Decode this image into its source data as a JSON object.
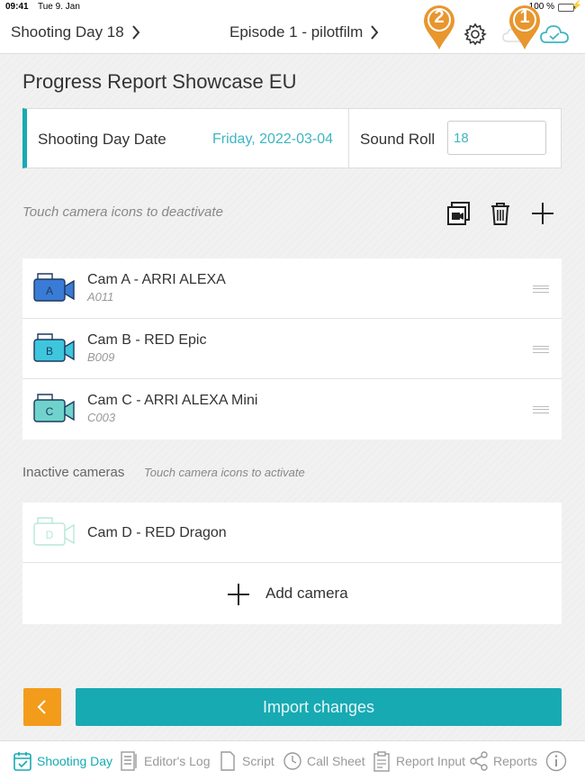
{
  "status_bar": {
    "time": "09:41",
    "date": "Tue 9. Jan",
    "battery": "100 %"
  },
  "nav": {
    "back_label": "Shooting Day 18",
    "episode_label": "Episode 1 - pilotfilm"
  },
  "markers": {
    "marker1": "1",
    "marker2": "2"
  },
  "page_title": "Progress Report Showcase EU",
  "shooting_day": {
    "date_label": "Shooting Day Date",
    "date_value": "Friday, 2022-03-04",
    "sound_roll_label": "Sound Roll",
    "sound_roll_value": "18"
  },
  "active_hint": "Touch camera icons to deactivate",
  "cameras": [
    {
      "letter": "A",
      "name": "Cam A - ARRI ALEXA",
      "code": "A011",
      "color": "#3a7bd5"
    },
    {
      "letter": "B",
      "name": "Cam B - RED Epic",
      "code": "B009",
      "color": "#3ec6dd"
    },
    {
      "letter": "C",
      "name": "Cam C - ARRI ALEXA Mini",
      "code": "C003",
      "color": "#6fd3cc"
    }
  ],
  "inactive": {
    "title": "Inactive cameras",
    "hint": "Touch camera icons to activate",
    "cameras": [
      {
        "letter": "D",
        "name": "Cam D - RED Dragon",
        "color": "#b8e8d9"
      }
    ],
    "add_label": "Add camera"
  },
  "import_label": "Import changes",
  "tabs": [
    {
      "label": "Shooting Day",
      "icon": "calendar-icon"
    },
    {
      "label": "Editor's Log",
      "icon": "editor-log-icon"
    },
    {
      "label": "Script",
      "icon": "script-icon"
    },
    {
      "label": "Call Sheet",
      "icon": "clock-icon"
    },
    {
      "label": "Report Input",
      "icon": "clipboard-icon"
    },
    {
      "label": "Reports",
      "icon": "share-icon"
    }
  ],
  "colors": {
    "accent": "#17aab3",
    "warning": "#f39c1c",
    "marker": "#e8962e"
  }
}
